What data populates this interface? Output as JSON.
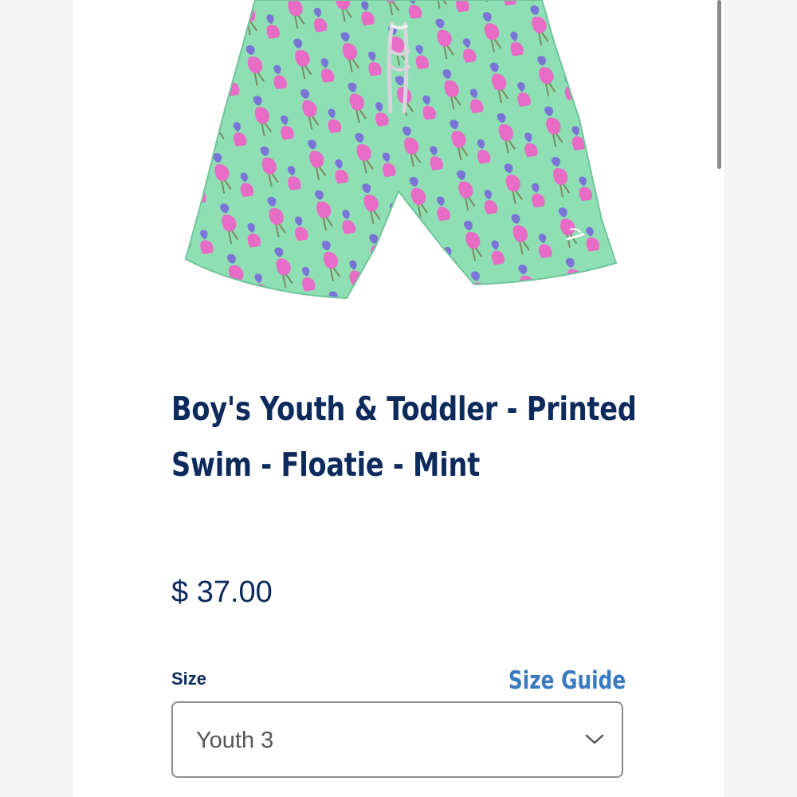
{
  "product": {
    "image_alt": "Mint green swim shorts with pink flamingo print",
    "image_colors": {
      "fabric": "#8ee0b4",
      "flamingo": "#e86bc6",
      "accent": "#7a74d6",
      "drawstring": "#d8d4dc"
    },
    "title": "Boy's Youth & Toddler - Printed Swim - Floatie - Mint",
    "price": "$ 37.00"
  },
  "size": {
    "label": "Size",
    "guide_link": "Size Guide",
    "selected": "Youth 3",
    "icon": "chevron-down-icon"
  },
  "theme": {
    "title_color": "#0d2a5c",
    "link_color": "#3a7bbf",
    "border_color": "#8e8e8e"
  }
}
